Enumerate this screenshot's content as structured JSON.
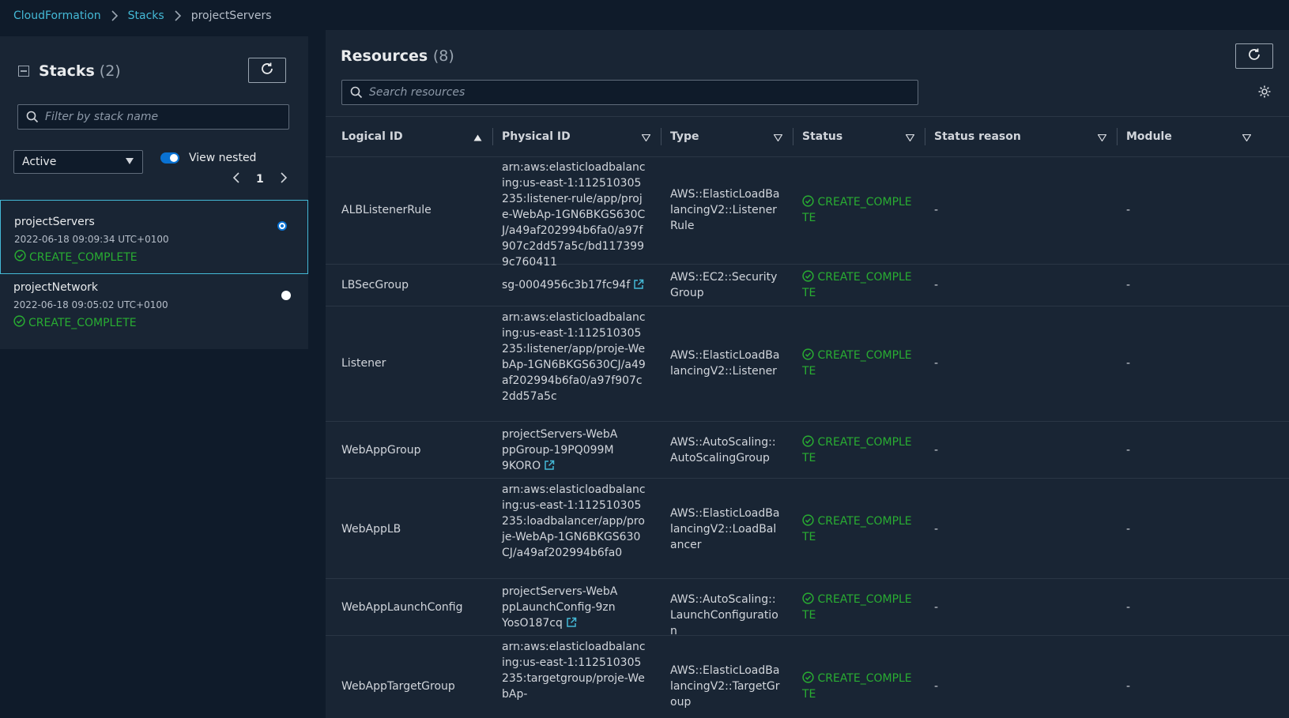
{
  "breadcrumb": {
    "root": "CloudFormation",
    "stacks": "Stacks",
    "current": "projectServers"
  },
  "left": {
    "title": "Stacks",
    "count": "(2)",
    "filter_placeholder": "Filter by stack name",
    "status_filter": "Active",
    "toggle_label": "View nested",
    "page": "1",
    "stacks": [
      {
        "name": "projectServers",
        "time": "2022-06-18 09:09:34 UTC+0100",
        "status": "CREATE_COMPLETE",
        "selected": true
      },
      {
        "name": "projectNetwork",
        "time": "2022-06-18 09:05:02 UTC+0100",
        "status": "CREATE_COMPLETE",
        "selected": false
      }
    ]
  },
  "resources": {
    "title": "Resources",
    "count": "(8)",
    "search_placeholder": "Search resources",
    "columns": [
      "Logical ID",
      "Physical ID",
      "Type",
      "Status",
      "Status reason",
      "Module"
    ],
    "rows": [
      {
        "logical": "ALBListenerRule",
        "physical": "arn:aws:elasticloadbalancing:us-east-1:112510305235:listener-rule/app/proje-WebAp-1GN6BKGS630CJ/a49af202994b6fa0/a97f907c2dd57a5c/bd1173999c760411",
        "type": "AWS::ElasticLoadBalancingV2::ListenerRule",
        "status": "CREATE_COMPLETE",
        "reason": "-",
        "module": "-"
      },
      {
        "logical": "LBSecGroup",
        "physical": "sg-0004956c3b17fc94f",
        "type": "AWS::EC2::SecurityGroup",
        "status": "CREATE_COMPLETE",
        "reason": "-",
        "module": "-"
      },
      {
        "logical": "Listener",
        "physical": "arn:aws:elasticloadbalancing:us-east-1:112510305235:listener/app/proje-WebAp-1GN6BKGS630CJ/a49af202994b6fa0/a97f907c2dd57a5c",
        "type": "AWS::ElasticLoadBalancingV2::Listener",
        "status": "CREATE_COMPLETE",
        "reason": "-",
        "module": "-"
      },
      {
        "logical": "WebAppGroup",
        "physical": "projectServers-WebAppGroup-19PQ099M9KORO",
        "type": "AWS::AutoScaling::AutoScalingGroup",
        "status": "CREATE_COMPLETE",
        "reason": "-",
        "module": "-"
      },
      {
        "logical": "WebAppLB",
        "physical": "arn:aws:elasticloadbalancing:us-east-1:112510305235:loadbalancer/app/proje-WebAp-1GN6BKGS630CJ/a49af202994b6fa0",
        "type": "AWS::ElasticLoadBalancingV2::LoadBalancer",
        "status": "CREATE_COMPLETE",
        "reason": "-",
        "module": "-"
      },
      {
        "logical": "WebAppLaunchConfig",
        "physical": "projectServers-WebAppLaunchConfig-9znYosO187cq",
        "type": "AWS::AutoScaling::LaunchConfiguration",
        "status": "CREATE_COMPLETE",
        "reason": "-",
        "module": "-"
      },
      {
        "logical": "WebAppTargetGroup",
        "physical": "arn:aws:elasticloadbalancing:us-east-1:112510305235:targetgroup/proje-WebAp-",
        "type": "AWS::ElasticLoadBalancingV2::TargetGroup",
        "status": "CREATE_COMPLETE",
        "reason": "-",
        "module": "-"
      }
    ]
  },
  "colors": {
    "link": "#44b9d6",
    "success": "#29ad32",
    "accent": "#0972d3"
  }
}
